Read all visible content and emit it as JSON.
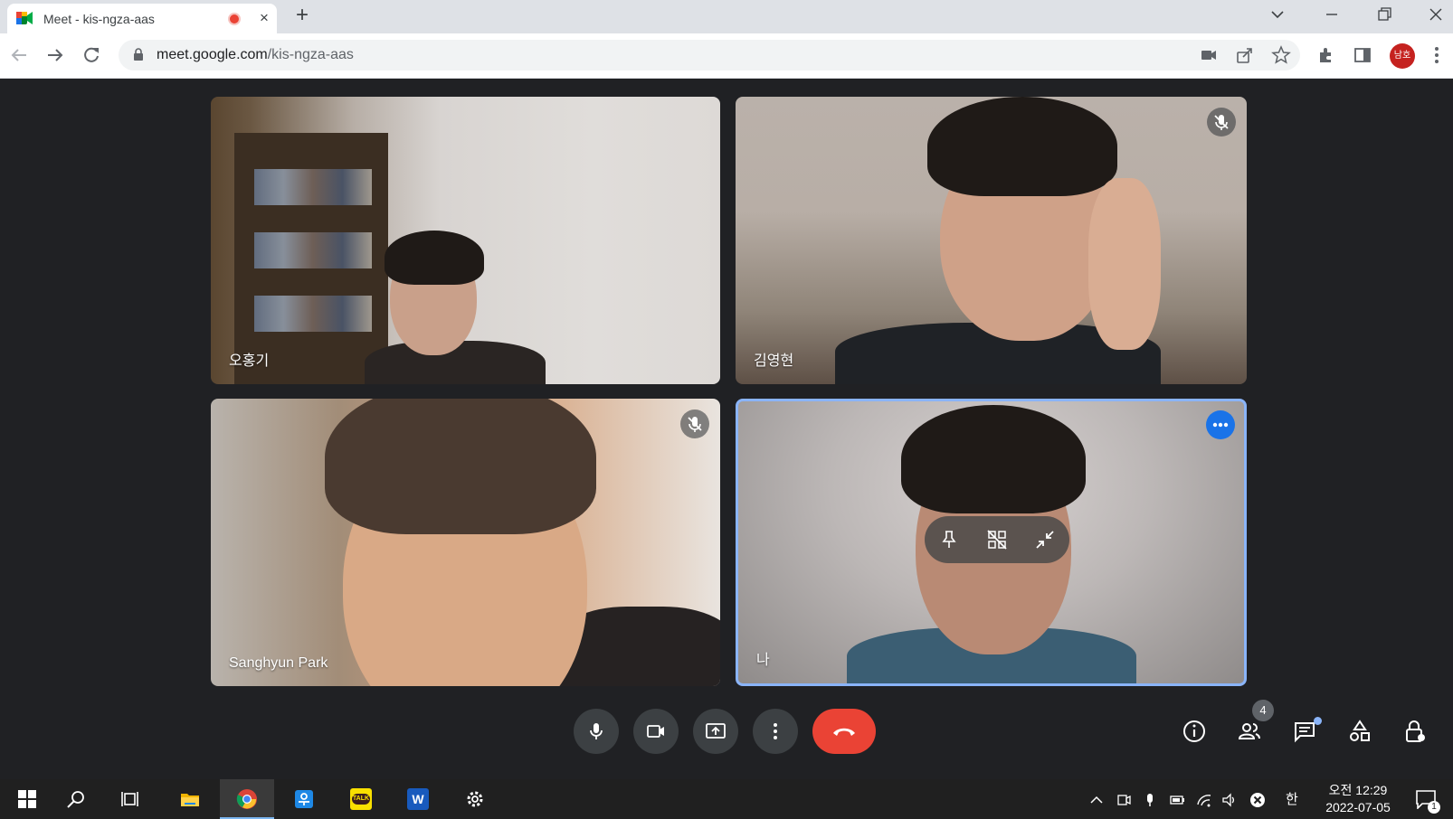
{
  "browser": {
    "tab_title": "Meet - kis-ngza-aas",
    "tab_close": "×",
    "new_tab": "+",
    "url_domain": "meet.google.com",
    "url_path": "/kis-ngza-aas",
    "profile_initials": "남호",
    "window_controls": [
      "chevron-down-icon",
      "minimize-icon",
      "restore-icon",
      "close-icon"
    ]
  },
  "meet": {
    "participants": [
      {
        "name": "오홍기",
        "muted": false
      },
      {
        "name": "김영현",
        "muted": true
      },
      {
        "name": "Sanghyun Park",
        "muted": true
      },
      {
        "name": "나",
        "muted": false,
        "self": true
      }
    ],
    "self_tile_actions": [
      "pin-icon",
      "remove-from-grid-icon",
      "minimize-icon"
    ],
    "controls": [
      "microphone-icon",
      "camera-icon",
      "present-screen-icon",
      "more-options-icon",
      "leave-call-icon"
    ],
    "side_controls": [
      "meeting-details-icon",
      "people-icon",
      "chat-icon",
      "activities-icon",
      "host-controls-icon"
    ],
    "people_count": "4"
  },
  "taskbar": {
    "apps": [
      "windows-start-icon",
      "search-icon",
      "task-view-icon",
      "file-explorer-icon",
      "chrome-icon",
      "hancom-icon",
      "kakaotalk-icon",
      "word-icon",
      "settings-icon"
    ],
    "kakao_label": "TALK",
    "word_label": "W",
    "ime_indicator": "한",
    "clock_time": "오전 12:29",
    "clock_date": "2022-07-05",
    "notification_count": "1",
    "colors": {
      "accent": "#7cb6f0"
    }
  },
  "colors": {
    "meet_background": "#202124",
    "leave_button": "#ea4335",
    "self_tile_border": "#8ab4f8",
    "more_button": "#1a73e8"
  }
}
